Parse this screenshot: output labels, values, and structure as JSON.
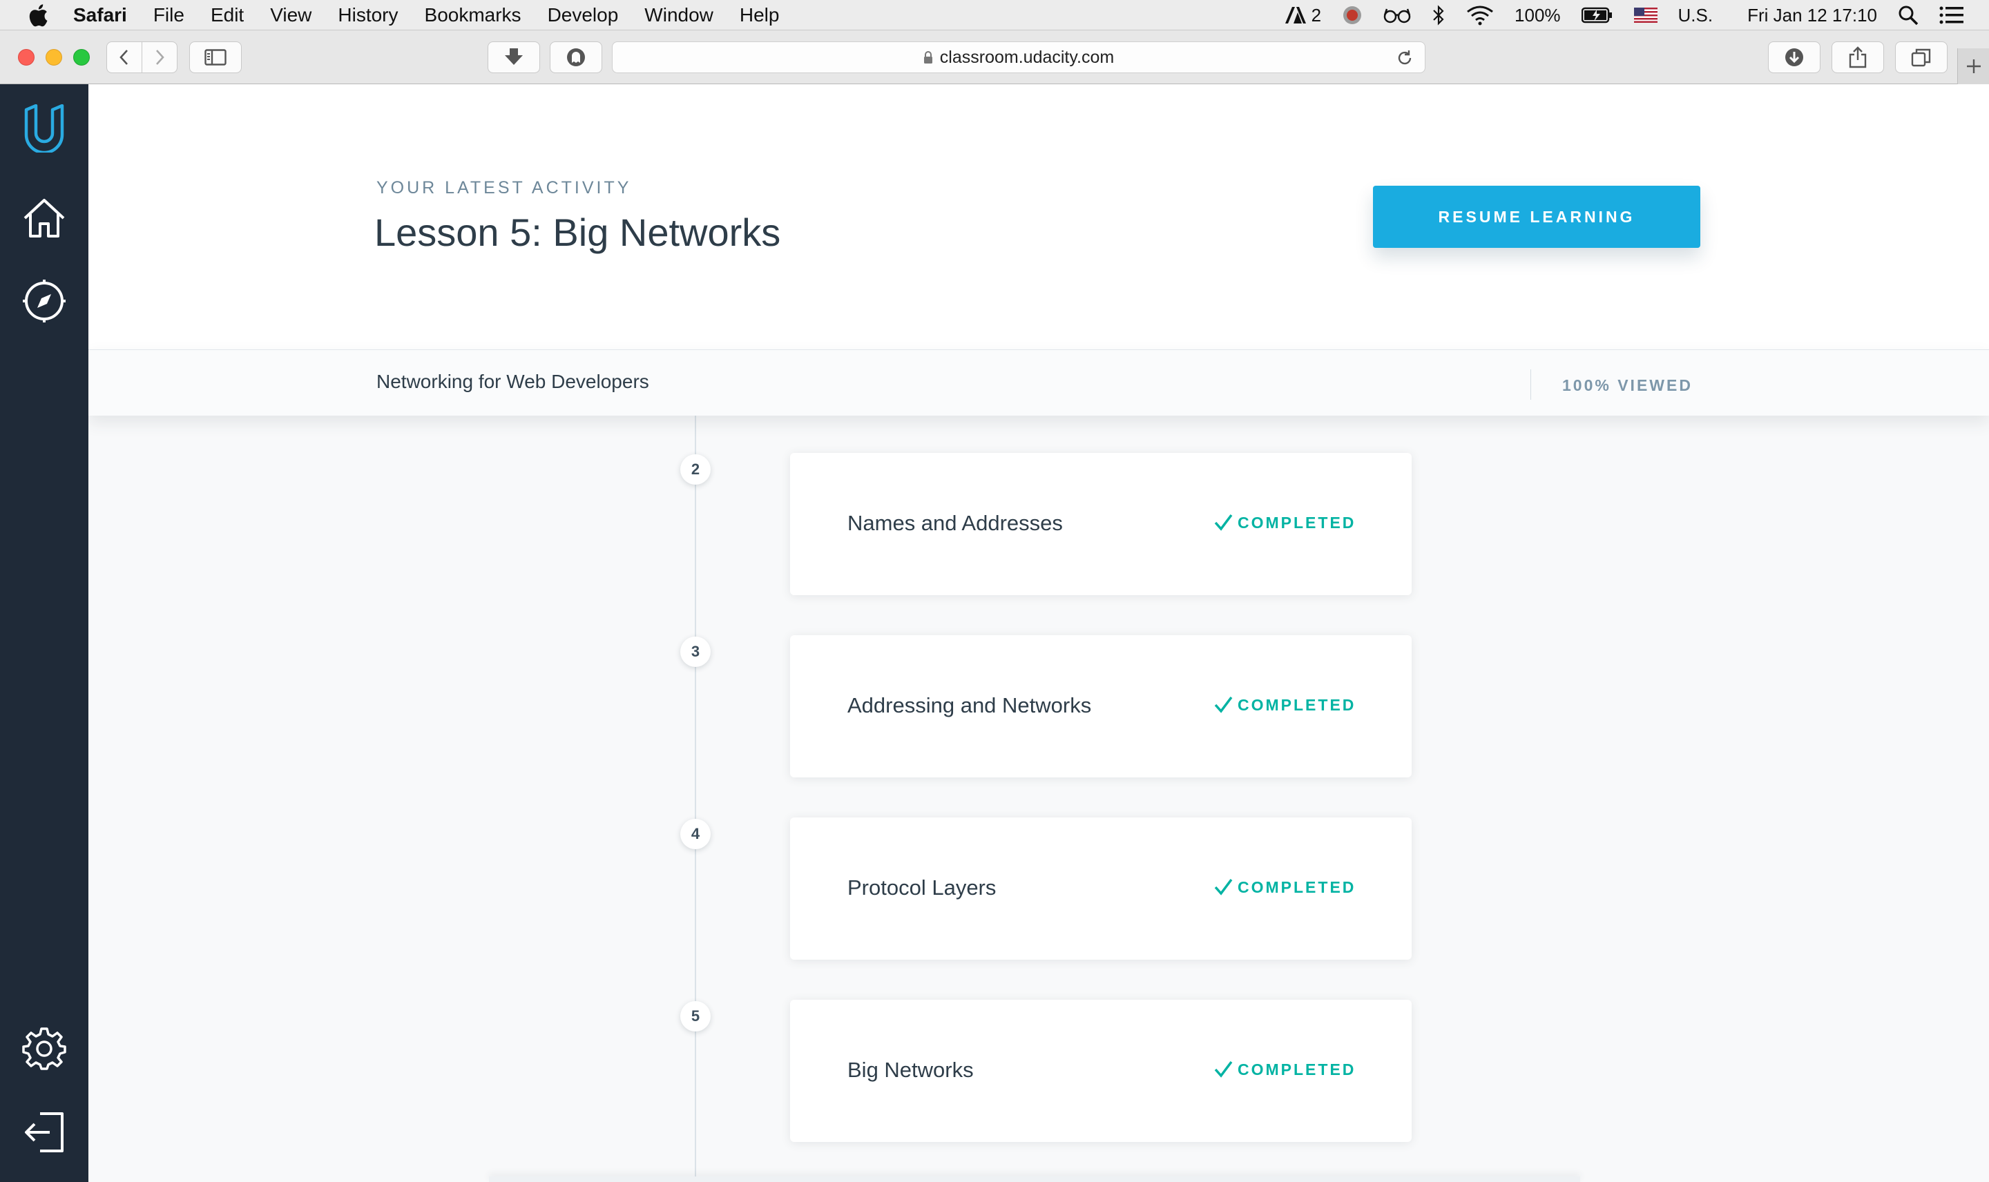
{
  "menubar": {
    "app_name": "Safari",
    "items": [
      "File",
      "Edit",
      "View",
      "History",
      "Bookmarks",
      "Develop",
      "Window",
      "Help"
    ],
    "status": {
      "adobe_count": "2",
      "battery": "100%",
      "input_source": "U.S.",
      "datetime": "Fri Jan 12  17:10"
    }
  },
  "browser": {
    "url": "classroom.udacity.com"
  },
  "header": {
    "eyebrow": "YOUR LATEST ACTIVITY",
    "lesson_title": "Lesson 5: Big Networks",
    "resume_label": "RESUME LEARNING"
  },
  "course_bar": {
    "course_name": "Networking for Web Developers",
    "progress_label": "100% VIEWED",
    "progress_fraction": 1.0
  },
  "lessons": [
    {
      "number": "2",
      "title": "Names and Addresses",
      "status": "COMPLETED"
    },
    {
      "number": "3",
      "title": "Addressing and Networks",
      "status": "COMPLETED"
    },
    {
      "number": "4",
      "title": "Protocol Layers",
      "status": "COMPLETED"
    },
    {
      "number": "5",
      "title": "Big Networks",
      "status": "COMPLETED"
    }
  ],
  "colors": {
    "accent": "#1aace0",
    "completed": "#02b3a3",
    "sidebar_bg": "#1f2a38",
    "logo": "#2aabe2"
  },
  "icons": {
    "sidebar_top": [
      "udacity-logo",
      "home-icon",
      "compass-icon"
    ],
    "sidebar_bottom": [
      "settings-icon",
      "logout-icon"
    ]
  }
}
